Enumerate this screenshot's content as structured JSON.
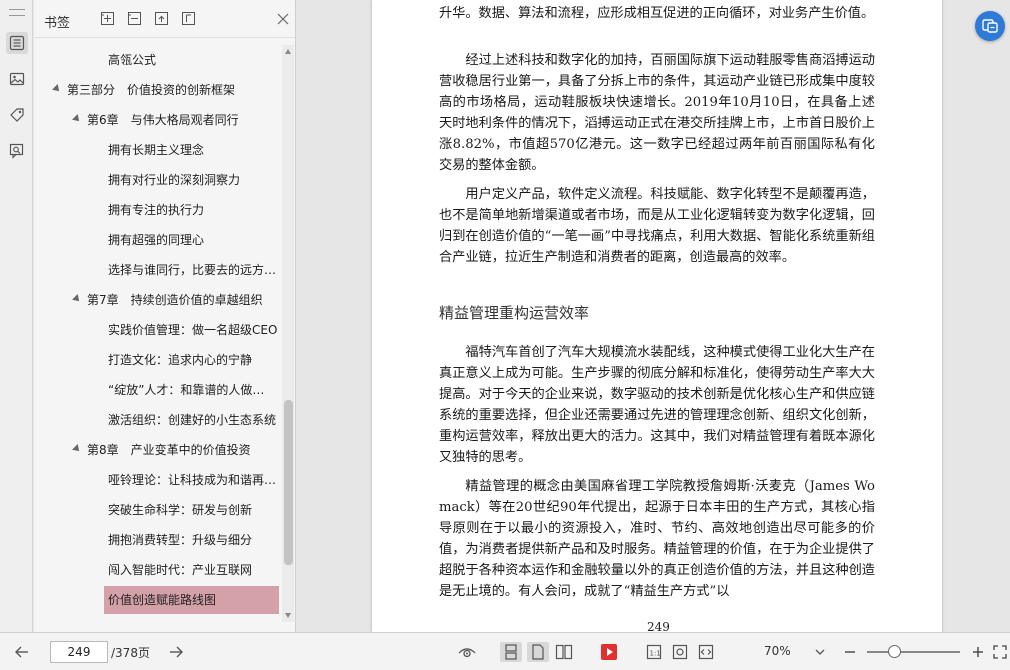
{
  "sidebar_rail": {
    "icons": [
      "bookmark-list-icon",
      "image-icon",
      "tag-icon",
      "comment-search-icon"
    ]
  },
  "bookmarks": {
    "title": "书签",
    "items": [
      {
        "label": "高瓴公式",
        "level": 2
      },
      {
        "label": "第三部分　价值投资的创新框架",
        "level": 0,
        "expanded": true
      },
      {
        "label": "第6章　与伟大格局观者同行",
        "level": 1,
        "expanded": true
      },
      {
        "label": "拥有长期主义理念",
        "level": 2
      },
      {
        "label": "拥有对行业的深刻洞察力",
        "level": 2
      },
      {
        "label": "拥有专注的执行力",
        "level": 2
      },
      {
        "label": "拥有超强的同理心",
        "level": 2
      },
      {
        "label": "选择与谁同行，比要去的远方…",
        "level": 2
      },
      {
        "label": "第7章　持续创造价值的卓越组织",
        "level": 1,
        "expanded": true
      },
      {
        "label": "实践价值管理：做一名超级CEO",
        "level": 2
      },
      {
        "label": "打造文化：追求内心的宁静",
        "level": 2
      },
      {
        "label": "“绽放”人才：和靠谱的人做…",
        "level": 2
      },
      {
        "label": "激活组织：创建好的小生态系统",
        "level": 2
      },
      {
        "label": "第8章　产业变革中的价值投资",
        "level": 1,
        "expanded": true
      },
      {
        "label": "哑铃理论：让科技成为和谐再…",
        "level": 2
      },
      {
        "label": "突破生命科学：研发与创新",
        "level": 2
      },
      {
        "label": "拥抱消费转型：升级与细分",
        "level": 2
      },
      {
        "label": "闯入智能时代：产业互联网",
        "level": 2
      },
      {
        "label": "价值创造赋能路线图",
        "level": 2,
        "selected": true
      }
    ]
  },
  "document": {
    "p1": "升华。数据、算法和流程，应形成相互促进的正向循环，对业务产生价值。",
    "p2": "经过上述科技和数字化的加持，百丽国际旗下运动鞋服零售商滔搏运动营收稳居行业第一，具备了分拆上市的条件，其运动产业链已形成集中度较高的市场格局，运动鞋服板块快速增长。2019年10月10日，在具备上述天时地利条件的情况下，滔搏运动正式在港交所挂牌上市，上市首日股价上涨8.82%，市值超570亿港元。这一数字已经超过两年前百丽国际私有化交易的整体金额。",
    "p3": "用户定义产品，软件定义流程。科技赋能、数字化转型不是颠覆再造，也不是简单地新增渠道或者市场，而是从工业化逻辑转变为数字化逻辑，回归到在创造价值的“一笔一画”中寻找痛点，利用大数据、智能化系统重新组合产业链，拉近生产制造和消费者的距离，创造最高的效率。",
    "heading": "精益管理重构运营效率",
    "p4": "福特汽车首创了汽车大规模流水装配线，这种模式使得工业化大生产在真正意义上成为可能。生产步骤的彻底分解和标准化，使得劳动生产率大大提高。对于今天的企业来说，数字驱动的技术创新是优化核心生产和供应链系统的重要选择，但企业还需要通过先进的管理理念创新、组织文化创新，重构运营效率，释放出更大的活力。这其中，我们对精益管理有着既本源化又独特的思考。",
    "p5": "精益管理的概念由美国麻省理工学院教授詹姆斯·沃麦克（James Womack）等在20世纪90年代提出，起源于日本丰田的生产方式，其核心指导原则在于以最小的资源投入，准时、节约、高效地创造出尽可能多的价值，为消费者提供新产品和及时服务。精益管理的价值，在于为企业提供了超脱于各种资本运作和金融较量以外的真正创造价值的方法，并且这种创造是无止境的。有人会问，成就了“精益生产方式”以",
    "page_number": "249"
  },
  "toolbar": {
    "current_page": "249",
    "total_pages": "/378页",
    "zoom": "70%",
    "zoom_level_fraction": 0.3
  }
}
